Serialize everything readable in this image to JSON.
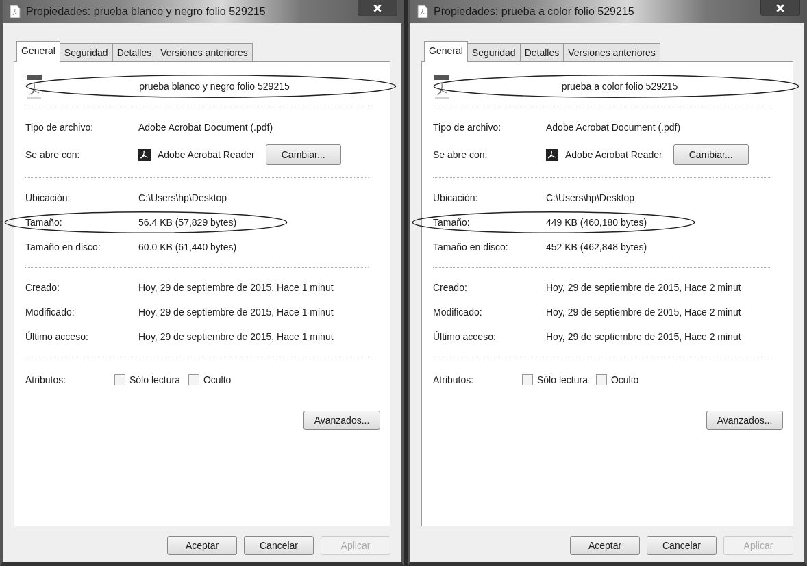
{
  "dialogs": [
    {
      "title": "Propiedades: prueba blanco y negro folio 529215",
      "tabs": [
        {
          "label": "General",
          "selected": true
        },
        {
          "label": "Seguridad",
          "selected": false
        },
        {
          "label": "Detalles",
          "selected": false
        },
        {
          "label": "Versiones anteriores",
          "selected": false
        }
      ],
      "file_name": {
        "text": "prueba blanco y negro folio 529215",
        "circled": true
      },
      "sections": [
        [
          {
            "kind": "text",
            "label": "Tipo de archivo:",
            "value": "Adobe Acrobat Document (.pdf)",
            "circled": false
          },
          {
            "kind": "app",
            "label": "Se abre con:",
            "value": "Adobe Acrobat Reader",
            "button": "Cambiar...",
            "circled": false
          }
        ],
        [
          {
            "kind": "text",
            "label": "Ubicación:",
            "value": "C:\\Users\\hp\\Desktop",
            "circled": false
          },
          {
            "kind": "text",
            "label": "Tamaño:",
            "value": "56.4 KB (57,829 bytes)",
            "circled": true
          },
          {
            "kind": "text",
            "label": "Tamaño en disco:",
            "value": "60.0 KB (61,440 bytes)",
            "circled": false
          }
        ],
        [
          {
            "kind": "text",
            "label": "Creado:",
            "value": "Hoy, 29 de septiembre de 2015, Hace 1 minut",
            "circled": false
          },
          {
            "kind": "text",
            "label": "Modificado:",
            "value": "Hoy, 29 de septiembre de 2015, Hace 1 minut",
            "circled": false
          },
          {
            "kind": "text",
            "label": "Último acceso:",
            "value": "Hoy, 29 de septiembre de 2015, Hace 1 minut",
            "circled": false
          }
        ]
      ],
      "attributes": {
        "label": "Atributos:",
        "options": [
          {
            "label": "Sólo lectura",
            "checked": false
          },
          {
            "label": "Oculto",
            "checked": false
          }
        ]
      },
      "advanced_button": "Avanzados...",
      "buttons": [
        {
          "label": "Aceptar",
          "disabled": false
        },
        {
          "label": "Cancelar",
          "disabled": false
        },
        {
          "label": "Aplicar",
          "disabled": true
        }
      ]
    },
    {
      "title": "Propiedades: prueba a color folio 529215",
      "tabs": [
        {
          "label": "General",
          "selected": true
        },
        {
          "label": "Seguridad",
          "selected": false
        },
        {
          "label": "Detalles",
          "selected": false
        },
        {
          "label": "Versiones anteriores",
          "selected": false
        }
      ],
      "file_name": {
        "text": "prueba a color folio 529215",
        "circled": true
      },
      "sections": [
        [
          {
            "kind": "text",
            "label": "Tipo de archivo:",
            "value": "Adobe Acrobat Document (.pdf)",
            "circled": false
          },
          {
            "kind": "app",
            "label": "Se abre con:",
            "value": "Adobe Acrobat Reader",
            "button": "Cambiar...",
            "circled": false
          }
        ],
        [
          {
            "kind": "text",
            "label": "Ubicación:",
            "value": "C:\\Users\\hp\\Desktop",
            "circled": false
          },
          {
            "kind": "text",
            "label": "Tamaño:",
            "value": "449 KB (460,180 bytes)",
            "circled": true
          },
          {
            "kind": "text",
            "label": "Tamaño en disco:",
            "value": "452 KB (462,848 bytes)",
            "circled": false
          }
        ],
        [
          {
            "kind": "text",
            "label": "Creado:",
            "value": "Hoy, 29 de septiembre de 2015, Hace 2 minut",
            "circled": false
          },
          {
            "kind": "text",
            "label": "Modificado:",
            "value": "Hoy, 29 de septiembre de 2015, Hace 2 minut",
            "circled": false
          },
          {
            "kind": "text",
            "label": "Último acceso:",
            "value": "Hoy, 29 de septiembre de 2015, Hace 2 minut",
            "circled": false
          }
        ]
      ],
      "attributes": {
        "label": "Atributos:",
        "options": [
          {
            "label": "Sólo lectura",
            "checked": false
          },
          {
            "label": "Oculto",
            "checked": false
          }
        ]
      },
      "advanced_button": "Avanzados...",
      "buttons": [
        {
          "label": "Aceptar",
          "disabled": false
        },
        {
          "label": "Cancelar",
          "disabled": false
        },
        {
          "label": "Aplicar",
          "disabled": true
        }
      ]
    }
  ]
}
